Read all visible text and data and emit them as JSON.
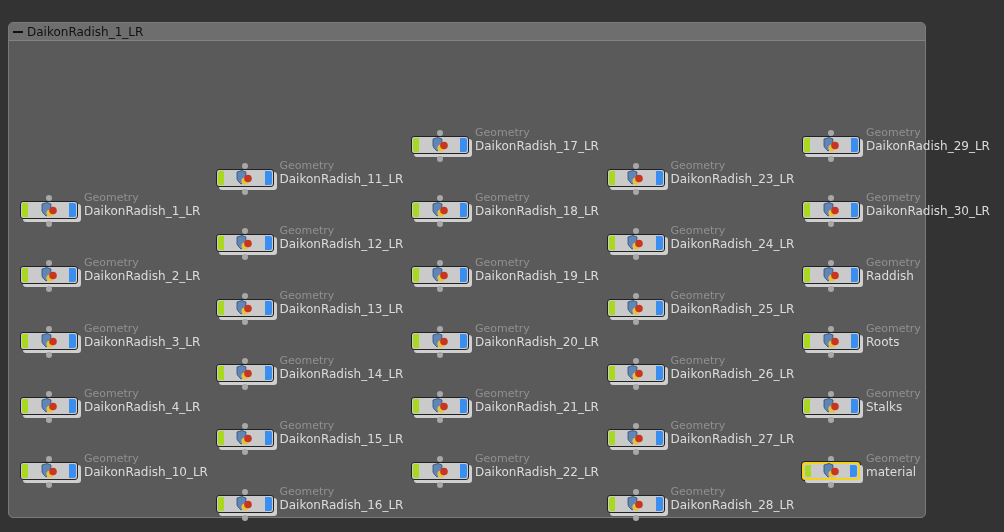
{
  "network_box": {
    "title": "DaikonRadish_1_LR",
    "collapsed": false
  },
  "columns": [
    {
      "nodes": [
        {
          "type": "Geometry",
          "name": "DaikonRadish_1_LR",
          "selected": false
        },
        {
          "type": "Geometry",
          "name": "DaikonRadish_2_LR",
          "selected": false
        },
        {
          "type": "Geometry",
          "name": "DaikonRadish_3_LR",
          "selected": false
        },
        {
          "type": "Geometry",
          "name": "DaikonRadish_4_LR",
          "selected": false
        },
        {
          "type": "Geometry",
          "name": "DaikonRadish_10_LR",
          "selected": false
        }
      ]
    },
    {
      "nodes": [
        {
          "type": "Geometry",
          "name": "DaikonRadish_11_LR",
          "selected": false
        },
        {
          "type": "Geometry",
          "name": "DaikonRadish_12_LR",
          "selected": false
        },
        {
          "type": "Geometry",
          "name": "DaikonRadish_13_LR",
          "selected": false
        },
        {
          "type": "Geometry",
          "name": "DaikonRadish_14_LR",
          "selected": false
        },
        {
          "type": "Geometry",
          "name": "DaikonRadish_15_LR",
          "selected": false
        },
        {
          "type": "Geometry",
          "name": "DaikonRadish_16_LR",
          "selected": false
        }
      ]
    },
    {
      "nodes": [
        {
          "type": "Geometry",
          "name": "DaikonRadish_17_LR",
          "selected": false
        },
        {
          "type": "Geometry",
          "name": "DaikonRadish_18_LR",
          "selected": false
        },
        {
          "type": "Geometry",
          "name": "DaikonRadish_19_LR",
          "selected": false
        },
        {
          "type": "Geometry",
          "name": "DaikonRadish_20_LR",
          "selected": false
        },
        {
          "type": "Geometry",
          "name": "DaikonRadish_21_LR",
          "selected": false
        },
        {
          "type": "Geometry",
          "name": "DaikonRadish_22_LR",
          "selected": false
        }
      ]
    },
    {
      "nodes": [
        {
          "type": "Geometry",
          "name": "DaikonRadish_23_LR",
          "selected": false
        },
        {
          "type": "Geometry",
          "name": "DaikonRadish_24_LR",
          "selected": false
        },
        {
          "type": "Geometry",
          "name": "DaikonRadish_25_LR",
          "selected": false
        },
        {
          "type": "Geometry",
          "name": "DaikonRadish_26_LR",
          "selected": false
        },
        {
          "type": "Geometry",
          "name": "DaikonRadish_27_LR",
          "selected": false
        },
        {
          "type": "Geometry",
          "name": "DaikonRadish_28_LR",
          "selected": false
        }
      ]
    },
    {
      "nodes": [
        {
          "type": "Geometry",
          "name": "DaikonRadish_29_LR",
          "selected": false
        },
        {
          "type": "Geometry",
          "name": "DaikonRadish_30_LR",
          "selected": false
        },
        {
          "type": "Geometry",
          "name": "Raddish",
          "selected": false
        },
        {
          "type": "Geometry",
          "name": "Roots",
          "selected": false
        },
        {
          "type": "Geometry",
          "name": "Stalks",
          "selected": false
        },
        {
          "type": "Geometry",
          "name": "material",
          "selected": true
        }
      ]
    }
  ]
}
